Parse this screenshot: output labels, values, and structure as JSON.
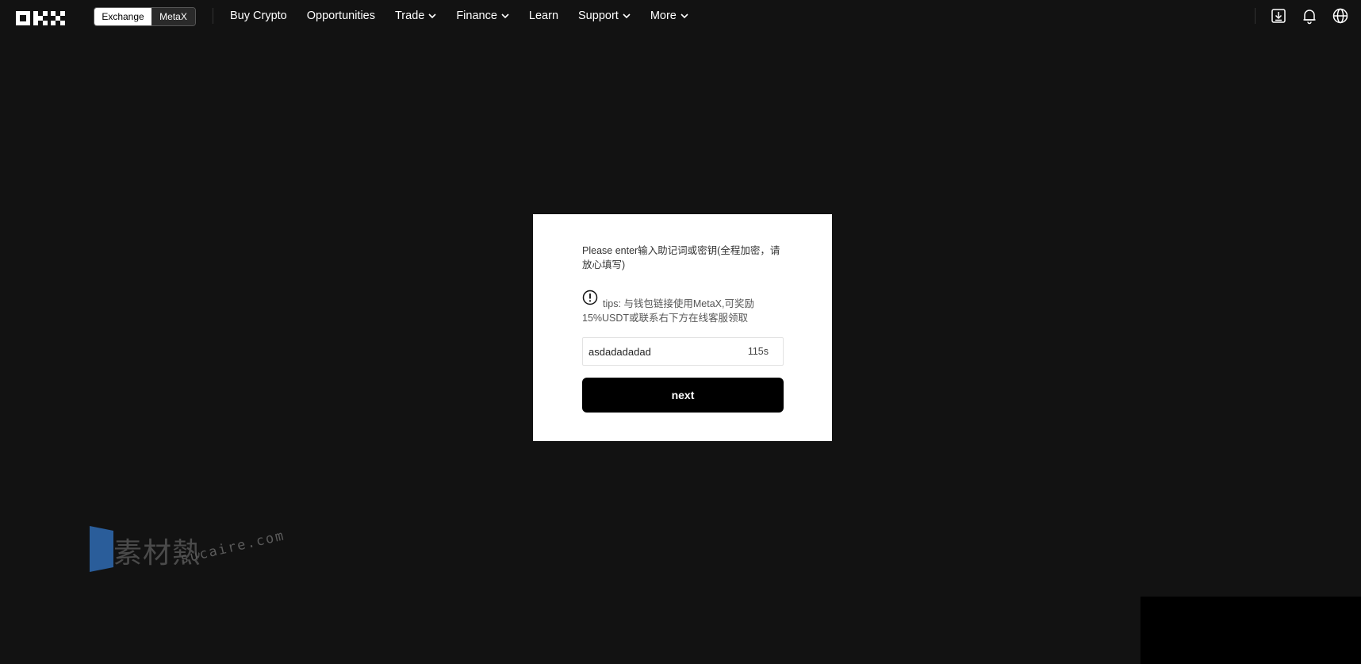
{
  "header": {
    "logo": "OKX",
    "switch": {
      "exchange_label": "Exchange",
      "metax_label": "MetaX"
    },
    "nav": [
      {
        "label": "Buy Crypto",
        "dropdown": false
      },
      {
        "label": "Opportunities",
        "dropdown": false
      },
      {
        "label": "Trade",
        "dropdown": true
      },
      {
        "label": "Finance",
        "dropdown": true
      },
      {
        "label": "Learn",
        "dropdown": false
      },
      {
        "label": "Support",
        "dropdown": true
      },
      {
        "label": "More",
        "dropdown": true
      }
    ],
    "icons": [
      "download-icon",
      "bell-icon",
      "globe-icon"
    ]
  },
  "dialog": {
    "prompt": "Please enter输入助记词或密钥(全程加密，请放心填写)",
    "tips": "tips: 与钱包链接使用MetaX,可奖励15%USDT或联系右下方在线客服领取",
    "input_value": "asdadadadad",
    "timer": "115s",
    "next_label": "next"
  },
  "watermark": {
    "text": "素材熱",
    "sub": "sucaire.com"
  },
  "colors": {
    "background": "#121212",
    "card": "#ffffff",
    "button": "#000000"
  }
}
